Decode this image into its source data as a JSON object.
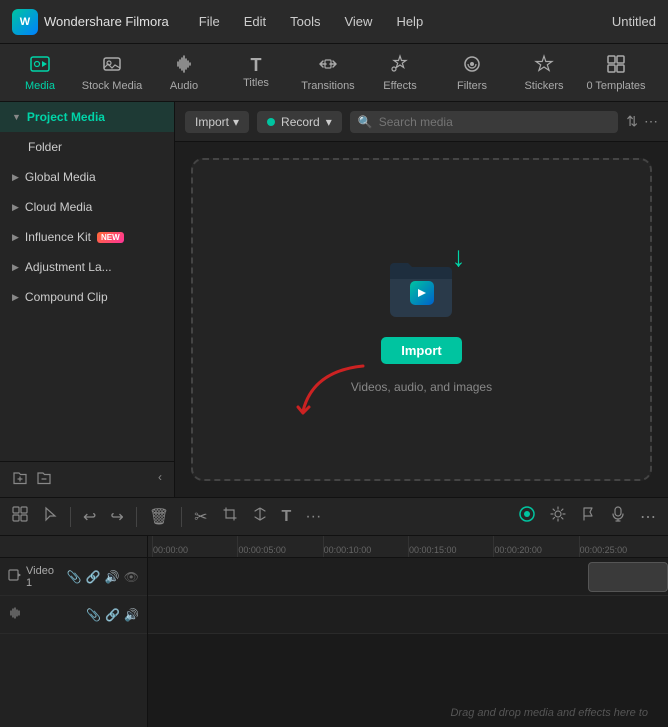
{
  "app": {
    "name": "Wondershare Filmora",
    "project_name": "Untitled"
  },
  "menu": {
    "items": [
      "File",
      "Edit",
      "Tools",
      "View",
      "Help"
    ]
  },
  "toolbar": {
    "items": [
      {
        "id": "media",
        "label": "Media",
        "icon": "🎬",
        "active": true
      },
      {
        "id": "stock-media",
        "label": "Stock Media",
        "icon": "📷"
      },
      {
        "id": "audio",
        "label": "Audio",
        "icon": "🎵"
      },
      {
        "id": "titles",
        "label": "Titles",
        "icon": "T"
      },
      {
        "id": "transitions",
        "label": "Transitions",
        "icon": "⟷"
      },
      {
        "id": "effects",
        "label": "Effects",
        "icon": "✨"
      },
      {
        "id": "filters",
        "label": "Filters",
        "icon": "🔮"
      },
      {
        "id": "stickers",
        "label": "Stickers",
        "icon": "⭐"
      },
      {
        "id": "templates",
        "label": "0 Templates",
        "icon": "⊞"
      }
    ]
  },
  "sidebar": {
    "items": [
      {
        "id": "project-media",
        "label": "Project Media",
        "active": true
      },
      {
        "id": "folder",
        "label": "Folder",
        "indent": true
      },
      {
        "id": "global-media",
        "label": "Global Media"
      },
      {
        "id": "cloud-media",
        "label": "Cloud Media"
      },
      {
        "id": "influence-kit",
        "label": "Influence Kit",
        "badge": "NEW"
      },
      {
        "id": "adjustment-la",
        "label": "Adjustment La..."
      },
      {
        "id": "compound-clip",
        "label": "Compound Clip"
      }
    ]
  },
  "content": {
    "import_label": "Import",
    "record_label": "Record",
    "search_placeholder": "Search media",
    "drop_zone": {
      "import_button": "Import",
      "sub_text": "Videos, audio, and images"
    }
  },
  "timeline": {
    "toolbar_buttons": [
      "grid",
      "cursor",
      "undo",
      "redo",
      "delete",
      "cut",
      "crop",
      "split",
      "text",
      "more"
    ],
    "right_buttons": [
      "motion",
      "settings",
      "flag",
      "mic",
      "more2"
    ],
    "tracks": [
      {
        "id": "video1",
        "label": "Video 1",
        "icon": "🎬"
      },
      {
        "id": "audio1",
        "label": "",
        "icon": "🎵"
      }
    ],
    "ruler_marks": [
      "00:00:00",
      "00:00:05:00",
      "00:00:10:00",
      "00:00:15:00",
      "00:00:20:00",
      "00:00:25:00"
    ],
    "drop_hint": "Drag and drop media and effects here to"
  }
}
